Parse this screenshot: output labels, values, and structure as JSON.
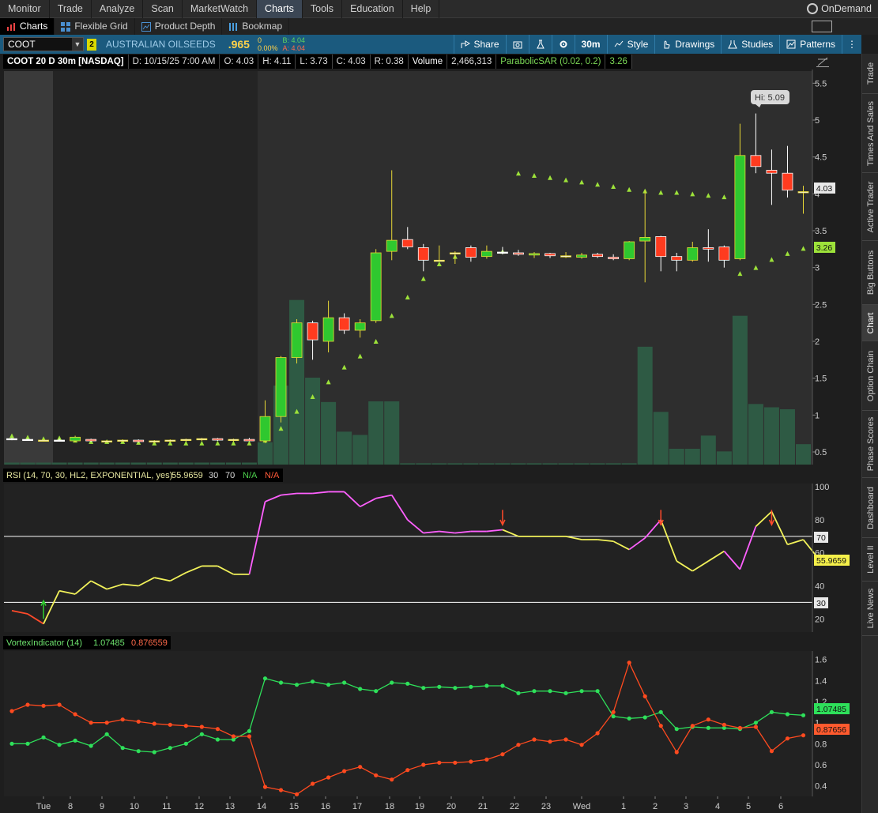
{
  "menu": {
    "items": [
      "Monitor",
      "Trade",
      "Analyze",
      "Scan",
      "MarketWatch",
      "Charts",
      "Tools",
      "Education",
      "Help"
    ],
    "active": "Charts",
    "ondemand": "OnDemand"
  },
  "subtabs": [
    "Charts",
    "Flexible Grid",
    "Product Depth",
    "Bookmap"
  ],
  "toolbar": {
    "symbol": "COOT",
    "link_badge": "2",
    "company": "AUSTRALIAN OILSEEDS",
    "last": ".965",
    "change": "0",
    "change_pct": "0.00%",
    "bid": "B: 4.04",
    "ask": "A: 4.04",
    "share": "Share",
    "interval": "30m",
    "style": "Style",
    "drawings": "Drawings",
    "studies": "Studies",
    "patterns": "Patterns"
  },
  "infobar": {
    "title": "COOT 20 D 30m [NASDAQ]",
    "date": "D: 10/15/25 7:00 AM",
    "open": "O: 4.03",
    "high": "H: 4.11",
    "low": "L: 3.73",
    "close": "C: 4.03",
    "range": "R: 0.38",
    "volume_label": "Volume",
    "volume_value": "2,466,313",
    "sar_label": "ParabolicSAR (0.02, 0.2)",
    "sar_value": "3.26"
  },
  "price_axis": {
    "ticks": [
      "5.5",
      "5",
      "4.5",
      "4",
      "3.5",
      "3",
      "2.5",
      "2",
      "1.5",
      "1",
      "0.5"
    ],
    "last_label": "4.03",
    "sar_label": "3.26",
    "hi_callout": "Hi: 5.09"
  },
  "rsi": {
    "label": "RSI (14, 70, 30, HL2, EXPONENTIAL, yes)",
    "value": "55.9659",
    "ob": "30",
    "os": "70",
    "na1": "N/A",
    "na2": "N/A",
    "ticks": [
      "100",
      "80",
      "60",
      "40",
      "20"
    ],
    "badge70": "70",
    "badge30": "30",
    "badge_value": "55.9659"
  },
  "vortex": {
    "label": "VortexIndicator (14)",
    "vip": "1.07485",
    "vim": "0.876559",
    "ticks": [
      "1.6",
      "1.4",
      "1.2",
      "1",
      "0.8",
      "0.6",
      "0.4"
    ],
    "badge_vip": "1.07485",
    "badge_vim": "0.87656"
  },
  "time_axis": [
    "Tue",
    "8",
    "9",
    "10",
    "11",
    "12",
    "13",
    "14",
    "15",
    "16",
    "17",
    "18",
    "19",
    "20",
    "21",
    "22",
    "23",
    "Wed",
    "1",
    "2",
    "3",
    "4",
    "5",
    "6"
  ],
  "side_tabs": [
    "Trade",
    "Times And Sales",
    "Active Trader",
    "Big Buttons",
    "Chart",
    "Option Chain",
    "Phase Scores",
    "Dashboard",
    "Level II",
    "Live News"
  ],
  "chart_data": [
    {
      "type": "candlestick",
      "title": "COOT 20 D 30m [NASDAQ]",
      "ylim": [
        0.35,
        5.6
      ],
      "candles": [
        [
          0.68,
          0.69,
          0.66,
          0.67
        ],
        [
          0.67,
          0.68,
          0.65,
          0.66
        ],
        [
          0.66,
          0.67,
          0.64,
          0.66
        ],
        [
          0.66,
          0.68,
          0.64,
          0.65
        ],
        [
          0.65,
          0.72,
          0.63,
          0.7
        ],
        [
          0.67,
          0.68,
          0.64,
          0.65
        ],
        [
          0.65,
          0.66,
          0.63,
          0.65
        ],
        [
          0.65,
          0.67,
          0.64,
          0.66
        ],
        [
          0.66,
          0.67,
          0.63,
          0.64
        ],
        [
          0.64,
          0.66,
          0.62,
          0.65
        ],
        [
          0.65,
          0.67,
          0.63,
          0.66
        ],
        [
          0.66,
          0.68,
          0.64,
          0.67
        ],
        [
          0.67,
          0.69,
          0.65,
          0.68
        ],
        [
          0.68,
          0.69,
          0.65,
          0.66
        ],
        [
          0.66,
          0.68,
          0.64,
          0.67
        ],
        [
          0.67,
          0.69,
          0.65,
          0.65
        ],
        [
          0.65,
          1.2,
          0.62,
          0.98
        ],
        [
          0.98,
          1.8,
          0.9,
          1.78
        ],
        [
          1.78,
          2.3,
          1.7,
          2.25
        ],
        [
          2.25,
          2.28,
          1.75,
          2.02
        ],
        [
          2.0,
          2.55,
          1.85,
          2.32
        ],
        [
          2.32,
          2.38,
          2.1,
          2.15
        ],
        [
          2.15,
          2.3,
          2.05,
          2.25
        ],
        [
          2.28,
          3.25,
          2.25,
          3.2
        ],
        [
          3.22,
          4.32,
          3.1,
          3.37
        ],
        [
          3.38,
          3.55,
          3.25,
          3.28
        ],
        [
          3.27,
          3.32,
          2.95,
          3.1
        ],
        [
          3.1,
          3.3,
          3.08,
          3.1
        ],
        [
          3.2,
          3.22,
          3.05,
          3.2
        ],
        [
          3.27,
          3.3,
          3.08,
          3.14
        ],
        [
          3.15,
          3.3,
          3.12,
          3.22
        ],
        [
          3.21,
          3.28,
          3.18,
          3.2
        ],
        [
          3.2,
          3.24,
          3.16,
          3.18
        ],
        [
          3.17,
          3.21,
          3.13,
          3.19
        ],
        [
          3.19,
          3.2,
          3.13,
          3.16
        ],
        [
          3.16,
          3.21,
          3.13,
          3.16
        ],
        [
          3.14,
          3.2,
          3.12,
          3.17
        ],
        [
          3.18,
          3.2,
          3.13,
          3.15
        ],
        [
          3.14,
          3.18,
          3.1,
          3.12
        ],
        [
          3.12,
          3.36,
          3.1,
          3.35
        ],
        [
          3.36,
          4.05,
          2.8,
          3.41
        ],
        [
          3.42,
          3.43,
          2.95,
          3.15
        ],
        [
          3.15,
          3.2,
          2.95,
          3.1
        ],
        [
          3.1,
          3.35,
          3.08,
          3.27
        ],
        [
          3.27,
          3.52,
          3.08,
          3.25
        ],
        [
          3.28,
          3.3,
          3.0,
          3.1
        ],
        [
          3.12,
          4.95,
          3.1,
          4.52
        ],
        [
          4.52,
          5.09,
          4.28,
          4.37
        ],
        [
          4.32,
          4.6,
          3.85,
          4.28
        ],
        [
          4.28,
          4.65,
          3.95,
          4.05
        ],
        [
          4.03,
          4.11,
          3.73,
          4.03
        ]
      ],
      "sar": [
        0.72,
        0.7,
        0.68,
        0.69,
        0.66,
        0.64,
        0.64,
        0.64,
        0.63,
        0.62,
        0.62,
        0.62,
        0.62,
        0.62,
        0.62,
        0.62,
        0.66,
        0.82,
        1.05,
        1.25,
        1.45,
        1.65,
        1.8,
        2.0,
        2.35,
        2.6,
        2.85,
        3.05,
        3.15,
        3.18,
        3.2,
        3.22,
        4.28,
        4.25,
        4.22,
        4.19,
        4.16,
        4.13,
        4.1,
        4.06,
        4.04,
        4.02,
        4.02,
        4.0,
        3.98,
        3.96,
        2.92,
        3.0,
        3.11,
        3.19,
        3.26
      ],
      "volume_ylim": [
        0,
        3.0
      ],
      "volume": [
        0.03,
        0.03,
        0.03,
        0.03,
        0.03,
        0.03,
        0.03,
        0.03,
        0.03,
        0.03,
        0.03,
        0.03,
        0.03,
        0.03,
        0.03,
        0.03,
        0.34,
        1.2,
        2.5,
        1.32,
        0.95,
        0.5,
        0.45,
        0.96,
        0.96,
        0.02,
        0.02,
        0.02,
        0.02,
        0.02,
        0.02,
        0.02,
        0.02,
        0.02,
        0.02,
        0.02,
        0.02,
        0.02,
        0.02,
        0.02,
        1.79,
        0.8,
        0.24,
        0.24,
        0.44,
        0.2,
        2.26,
        0.92,
        0.87,
        0.84,
        0.31
      ]
    },
    {
      "type": "line",
      "title": "RSI (14, 70, 30, HL2, EXPONENTIAL, yes)",
      "ylim": [
        12,
        102
      ],
      "levels": [
        70,
        30
      ],
      "values": [
        25,
        23,
        17,
        37,
        35,
        43,
        38,
        41,
        40,
        45,
        43,
        48,
        52,
        52,
        47,
        47,
        91,
        95,
        96,
        96,
        97,
        97,
        88,
        93,
        95,
        80,
        72,
        73,
        72,
        73,
        73,
        74,
        70,
        70,
        70,
        70,
        68,
        68,
        67,
        62,
        69,
        80,
        55,
        49,
        55,
        61,
        50,
        76,
        85,
        65,
        68,
        56
      ],
      "overbought_segments": [
        [
          16,
          31
        ],
        [
          40,
          41
        ],
        [
          46,
          47
        ]
      ]
    },
    {
      "type": "line",
      "title": "VortexIndicator (14)",
      "ylim": [
        0.3,
        1.68
      ],
      "series": [
        {
          "name": "VI+",
          "values": [
            0.8,
            0.8,
            0.86,
            0.79,
            0.83,
            0.78,
            0.89,
            0.76,
            0.73,
            0.72,
            0.76,
            0.8,
            0.89,
            0.84,
            0.84,
            0.92,
            1.42,
            1.38,
            1.36,
            1.39,
            1.36,
            1.38,
            1.32,
            1.3,
            1.38,
            1.37,
            1.33,
            1.34,
            1.33,
            1.34,
            1.35,
            1.35,
            1.28,
            1.3,
            1.3,
            1.28,
            1.3,
            1.3,
            1.06,
            1.04,
            1.05,
            1.1,
            0.94,
            0.96,
            0.95,
            0.95,
            0.94,
            1.0,
            1.1,
            1.08,
            1.07
          ]
        },
        {
          "name": "VI-",
          "values": [
            1.11,
            1.17,
            1.16,
            1.17,
            1.08,
            1.0,
            1.0,
            1.03,
            1.01,
            0.99,
            0.98,
            0.97,
            0.96,
            0.94,
            0.87,
            0.87,
            0.39,
            0.36,
            0.32,
            0.42,
            0.48,
            0.54,
            0.58,
            0.5,
            0.46,
            0.55,
            0.6,
            0.62,
            0.62,
            0.63,
            0.65,
            0.7,
            0.79,
            0.84,
            0.82,
            0.84,
            0.79,
            0.9,
            1.1,
            1.57,
            1.25,
            0.97,
            0.72,
            0.97,
            1.03,
            0.98,
            0.95,
            0.96,
            0.73,
            0.85,
            0.88
          ]
        }
      ]
    }
  ]
}
